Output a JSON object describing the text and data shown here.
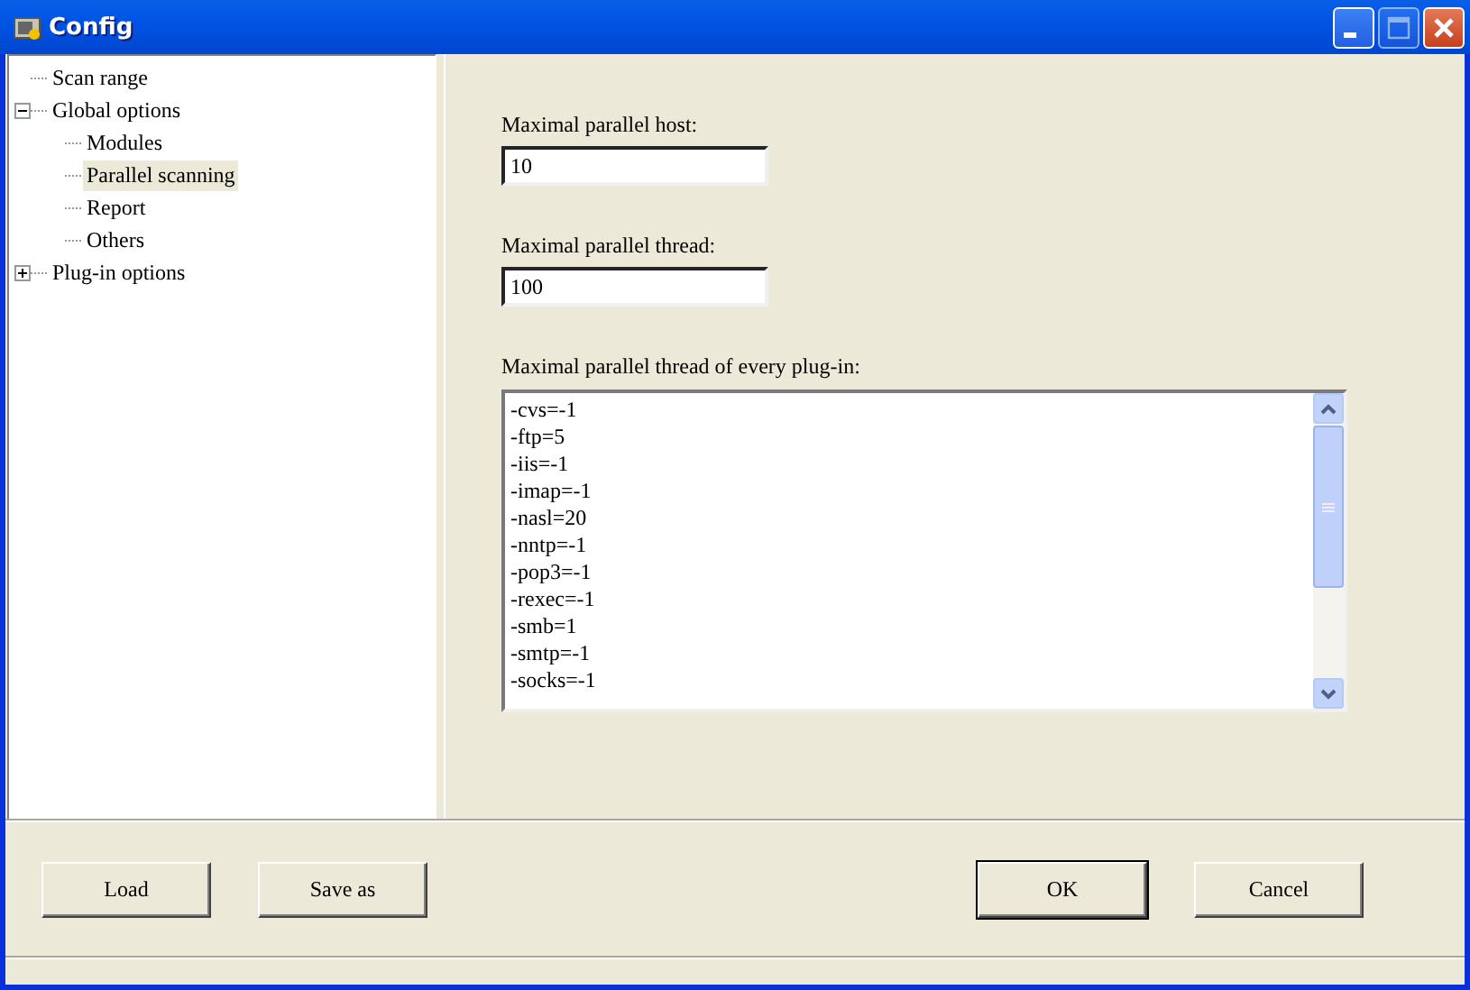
{
  "window": {
    "title": "Config",
    "controls": [
      {
        "kind": "minimize",
        "disabled": false
      },
      {
        "kind": "maximize",
        "disabled": true
      },
      {
        "kind": "close",
        "disabled": false
      }
    ]
  },
  "tree": [
    {
      "label": "Scan range",
      "selected": false
    },
    {
      "label": "Global options",
      "selected": false,
      "expanded": true,
      "children": [
        {
          "label": "Modules",
          "selected": false
        },
        {
          "label": "Parallel scanning",
          "selected": true
        },
        {
          "label": "Report",
          "selected": false
        },
        {
          "label": "Others",
          "selected": false
        }
      ]
    },
    {
      "label": "Plug-in options",
      "selected": false,
      "expanded": false
    }
  ],
  "fields": [
    {
      "label": "Maximal parallel host:",
      "value": "10"
    },
    {
      "label": "Maximal parallel thread:",
      "value": "100"
    }
  ],
  "plugin_threads": {
    "label": "Maximal parallel thread of every plug-in:",
    "lines": [
      "-cvs=-1",
      "-ftp=5",
      "-iis=-1",
      "-imap=-1",
      "-nasl=20",
      "-nntp=-1",
      "-pop3=-1",
      "-rexec=-1",
      "-smb=1",
      "-smtp=-1",
      "-socks=-1"
    ]
  },
  "left_buttons": [
    {
      "label": "Load",
      "default": false
    },
    {
      "label": "Save as",
      "default": false
    }
  ],
  "right_buttons": [
    {
      "label": "OK",
      "default": true
    },
    {
      "label": "Cancel",
      "default": false
    }
  ]
}
